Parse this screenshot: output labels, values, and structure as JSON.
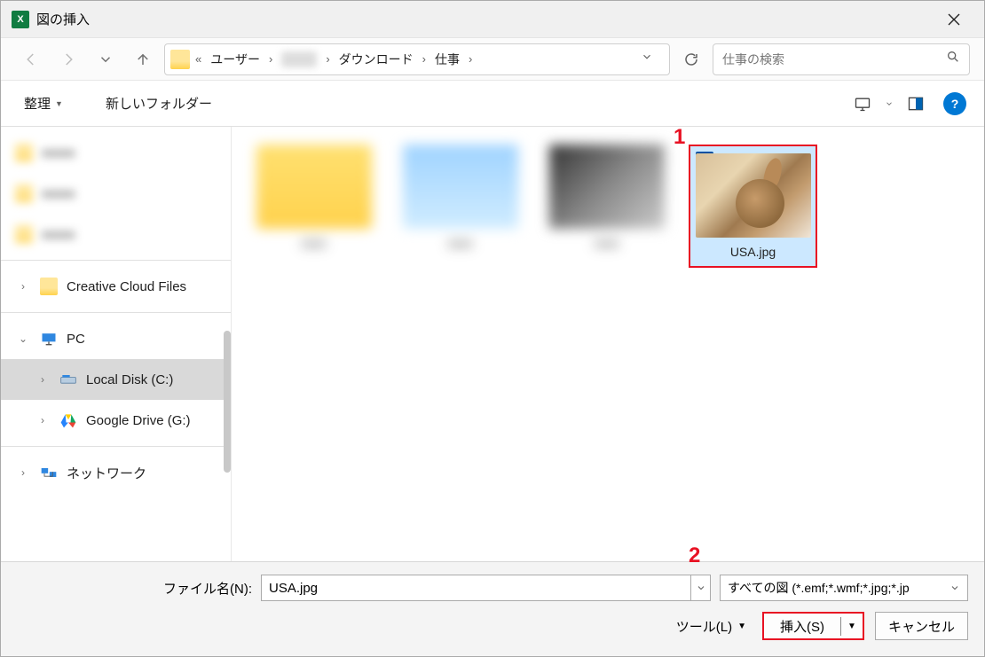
{
  "title": "図の挿入",
  "breadcrumbs": {
    "p0": "ユーザー",
    "p2": "ダウンロード",
    "p3": "仕事"
  },
  "search": {
    "placeholder": "仕事の検索"
  },
  "toolbar": {
    "organize": "整理",
    "newfolder": "新しいフォルダー"
  },
  "sidebar": {
    "ccf": "Creative Cloud Files",
    "pc": "PC",
    "ldisk": "Local Disk (C:)",
    "gdrive": "Google Drive (G:)",
    "network": "ネットワーク"
  },
  "file": {
    "selected_name": "USA.jpg"
  },
  "annotations": {
    "a1": "1",
    "a2": "2"
  },
  "footer": {
    "filename_label": "ファイル名(N):",
    "filename_value": "USA.jpg",
    "filetype": "すべての図 (*.emf;*.wmf;*.jpg;*.jp",
    "tools": "ツール(L)",
    "insert": "挿入(S)",
    "cancel": "キャンセル"
  }
}
